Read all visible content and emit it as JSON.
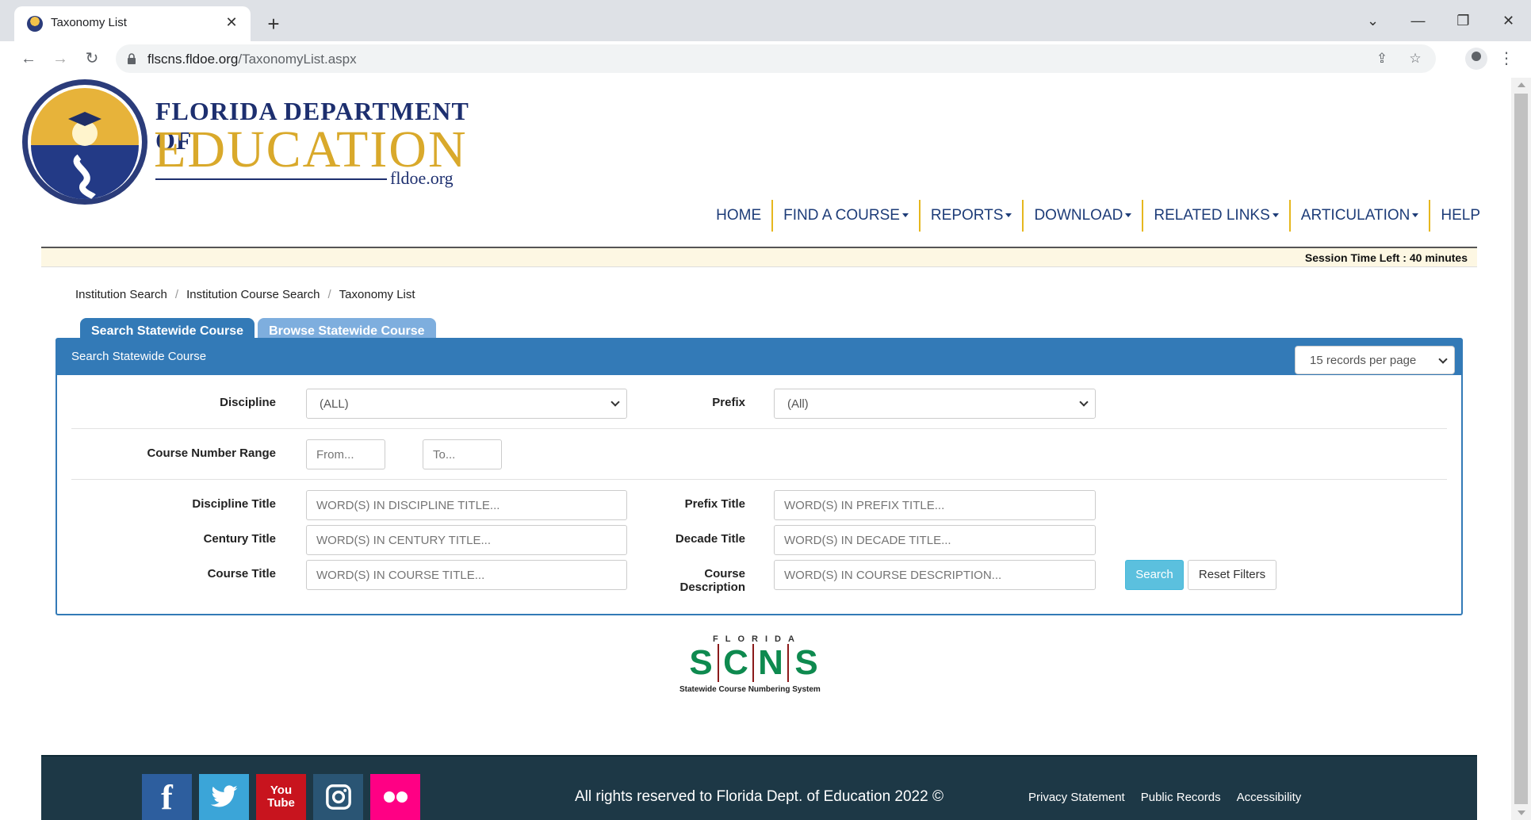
{
  "browser": {
    "tab_title": "Taxonomy List",
    "url_host": "flscns.fldoe.org",
    "url_path": "/TaxonomyList.aspx"
  },
  "logo": {
    "line1": "FLORIDA DEPARTMENT OF",
    "line2": "EDUCATION",
    "line3": "fldoe.org"
  },
  "nav": {
    "items": [
      {
        "label": "HOME",
        "dropdown": false
      },
      {
        "label": "FIND A COURSE",
        "dropdown": true
      },
      {
        "label": "REPORTS",
        "dropdown": true
      },
      {
        "label": "DOWNLOAD",
        "dropdown": true
      },
      {
        "label": "RELATED LINKS",
        "dropdown": true
      },
      {
        "label": "ARTICULATION",
        "dropdown": true
      },
      {
        "label": "HELP",
        "dropdown": false
      }
    ]
  },
  "session": {
    "text": "Session Time Left : 40 minutes"
  },
  "breadcrumb": {
    "items": [
      "Institution Search",
      "Institution Course Search",
      "Taxonomy List"
    ]
  },
  "tabs": {
    "search": "Search Statewide Course",
    "browse": "Browse Statewide Course"
  },
  "panel": {
    "title": "Search Statewide Course",
    "per_page": "15 records per page"
  },
  "form": {
    "discipline_label": "Discipline",
    "discipline_value": "(ALL)",
    "prefix_label": "Prefix",
    "prefix_value": "(All)",
    "range_label": "Course Number Range",
    "range_from_placeholder": "From...",
    "range_to_placeholder": "To...",
    "discipline_title_label": "Discipline Title",
    "discipline_title_placeholder": "WORD(S) IN DISCIPLINE TITLE...",
    "prefix_title_label": "Prefix Title",
    "prefix_title_placeholder": "WORD(S) IN PREFIX TITLE...",
    "century_title_label": "Century Title",
    "century_title_placeholder": "WORD(S) IN CENTURY TITLE...",
    "decade_title_label": "Decade Title",
    "decade_title_placeholder": "WORD(S) IN DECADE TITLE...",
    "course_title_label": "Course Title",
    "course_title_placeholder": "WORD(S) IN COURSE TITLE...",
    "course_description_label_1": "Course",
    "course_description_label_2": "Description",
    "course_description_placeholder": "WORD(S) IN COURSE DESCRIPTION...",
    "search_button": "Search",
    "reset_button": "Reset Filters"
  },
  "scns_logo": {
    "top": "FLORIDA",
    "letters": [
      "S",
      "C",
      "N",
      "S"
    ],
    "subtitle": "Statewide Course Numbering System"
  },
  "footer": {
    "copyright": "All rights reserved to Florida Dept. of Education 2022 ©",
    "links": [
      "Privacy Statement",
      "Public Records",
      "Accessibility"
    ],
    "social": {
      "youtube_1": "You",
      "youtube_2": "Tube"
    }
  },
  "colors": {
    "primary": "#337ab7",
    "nav_text": "#1d3c78",
    "nav_divider": "#e6b71e",
    "footer_bg": "#1d3846",
    "search_btn": "#5bc0de"
  }
}
